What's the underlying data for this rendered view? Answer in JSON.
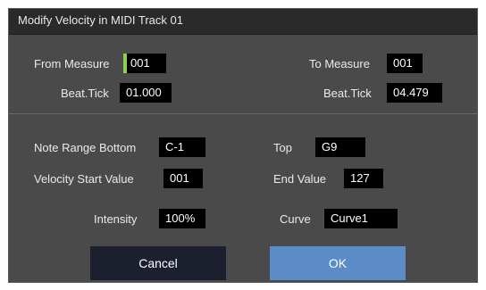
{
  "dialog": {
    "title": "Modify Velocity in MIDI Track 01",
    "from_measure": {
      "label": "From Measure",
      "value": "001"
    },
    "from_beat_tick": {
      "label": "Beat.Tick",
      "value": "01.000"
    },
    "to_measure": {
      "label": "To Measure",
      "value": "001"
    },
    "to_beat_tick": {
      "label": "Beat.Tick",
      "value": "04.479"
    },
    "note_range_bottom": {
      "label": "Note Range  Bottom",
      "value": "C-1"
    },
    "note_range_top": {
      "label": "Top",
      "value": "G9"
    },
    "velocity_start": {
      "label": "Velocity Start Value",
      "value": "001"
    },
    "velocity_end": {
      "label": "End Value",
      "value": "127"
    },
    "intensity": {
      "label": "Intensity",
      "value": "100%"
    },
    "curve": {
      "label": "Curve",
      "value": "Curve1"
    },
    "buttons": {
      "cancel": "Cancel",
      "ok": "OK"
    }
  },
  "colors": {
    "dialog_bg": "#4a4a4a",
    "titlebar_bg": "#2a2a2a",
    "field_bg": "#000000",
    "focus_indicator": "#8fd14f",
    "cancel_button": "#1b1f2e",
    "ok_button": "#5b8cc8"
  }
}
